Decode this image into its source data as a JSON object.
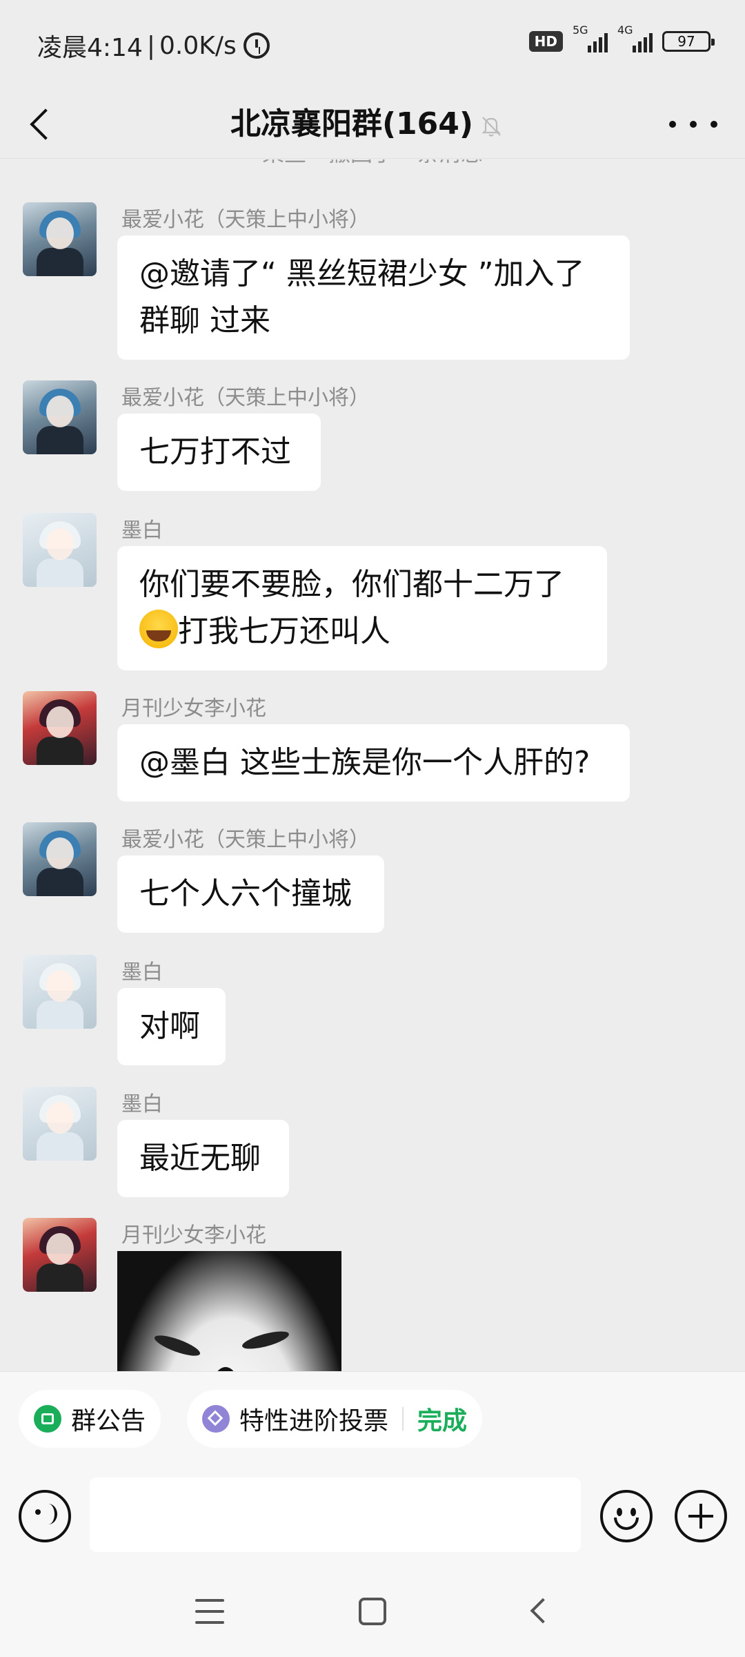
{
  "status_bar": {
    "time": "凌晨4:14",
    "network_speed": "0.0K/s",
    "hd_label": "HD",
    "net_5g": "5G",
    "net_4g": "4G",
    "battery": "97"
  },
  "header": {
    "title": "北凉襄阳群(164)"
  },
  "system_note": "某些一撤回了一条消息",
  "messages": [
    {
      "sender": "最爱小花（天策上中小将）",
      "avatar": "avatar-blue-hair",
      "text": "@邀请了“ 黑丝短裙少女 ”加入了群聊    过来"
    },
    {
      "sender": "最爱小花（天策上中小将）",
      "avatar": "avatar-blue-hair",
      "text": "七万打不过"
    },
    {
      "sender": "墨白",
      "avatar": "avatar-white-hair",
      "text_line1": "你们要不要脸，你们都十二万了",
      "text_line2": "打我七万还叫人"
    },
    {
      "sender": "月刊少女李小花",
      "avatar": "avatar-red-hair",
      "text": "@墨白   这些士族是你一个人肝的?"
    },
    {
      "sender": "最爱小花（天策上中小将）",
      "avatar": "avatar-blue-hair",
      "text": "七个人六个撞城"
    },
    {
      "sender": "墨白",
      "avatar": "avatar-white-hair",
      "text": "对啊"
    },
    {
      "sender": "墨白",
      "avatar": "avatar-white-hair",
      "text": "最近无聊"
    },
    {
      "sender": "月刊少女李小花",
      "avatar": "avatar-red-hair",
      "image": "meme-face-image"
    }
  ],
  "quick_bar": {
    "announcement": "群公告",
    "vote": "特性进阶投票",
    "done": "完成"
  },
  "input": {
    "placeholder": ""
  }
}
